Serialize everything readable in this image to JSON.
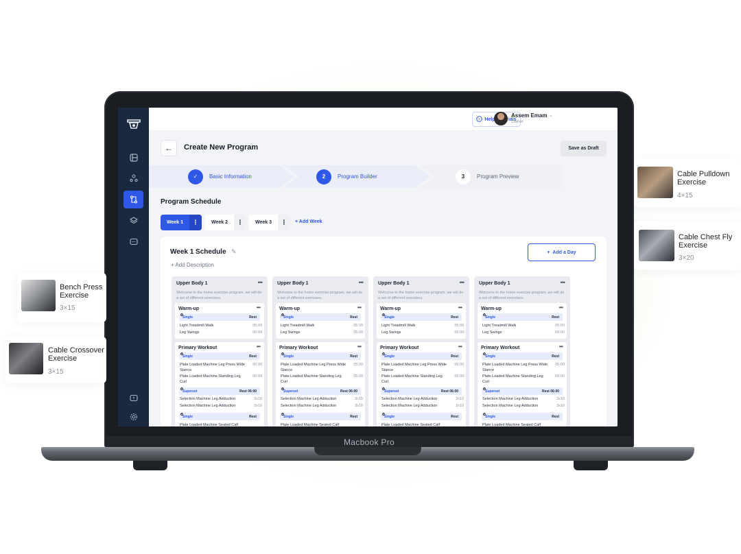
{
  "app": {
    "help_label": "Help Tutorials",
    "user_name": "Assem Emam",
    "user_role": "Owner",
    "page_title": "Create New Program",
    "save_draft_label": "Save as Draft"
  },
  "steps": [
    {
      "number": "1",
      "label": "Basic Information",
      "state": "done"
    },
    {
      "number": "2",
      "label": "Program Builder",
      "state": "active"
    },
    {
      "number": "3",
      "label": "Program Preview",
      "state": "pending"
    }
  ],
  "schedule": {
    "title": "Program Schedule",
    "weeks": [
      "Week 1",
      "Week 2",
      "Week 3"
    ],
    "add_week": "Add Week",
    "week_title": "Week 1  Schedule",
    "add_description": "Add Description",
    "add_day": "Add a Day"
  },
  "day": {
    "title": "Upper Body 1",
    "description": "Welcome to the home exercise program. we will do a set of different exercises.",
    "warmup_title": "Warm-up",
    "primary_title": "Primary Workout",
    "single_label": "Single",
    "superset_label": "Superset",
    "rest_label": "Rest",
    "rest_time_label": "Rest 06:00",
    "warmup": [
      {
        "name": "Light Treadmill Walk",
        "value": "05:00"
      },
      {
        "name": "Leg Swings",
        "value": "05:00"
      }
    ],
    "primary_single": [
      {
        "name": "Plate Loaded Machine Leg Press Wide Stance",
        "value": "05:00"
      },
      {
        "name": "Plate Loaded Machine Standing Leg Curl",
        "value": "05:00"
      }
    ],
    "superset": [
      {
        "name": "Selection Machine Leg Adduction",
        "value": "3x10"
      },
      {
        "name": "Selection Machine Leg Adduction",
        "value": "3x10"
      }
    ],
    "cut_text": "Plate Loaded Machine Seated Calf"
  },
  "cards": [
    {
      "title": "Cable Pulldown Exercise",
      "sets": "4×15"
    },
    {
      "title": "Cable Chest Fly Exercise",
      "sets": "3×20"
    },
    {
      "title": "Bench Press Exercise",
      "sets": "3×15"
    },
    {
      "title": "Cable Crossover Exercise",
      "sets": "3×15"
    }
  ],
  "device_label": "Macbook Pro",
  "colors": {
    "accent": "#2f57e8",
    "sidebar": "#19293f",
    "step_bg": "#eaedf8"
  }
}
